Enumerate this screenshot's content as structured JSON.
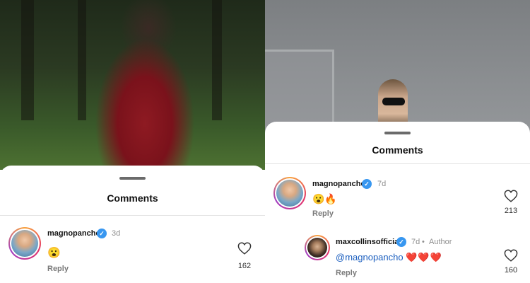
{
  "left_panel": {
    "sheet_title": "Comments",
    "comment": {
      "username": "magnopancho",
      "time": "3d",
      "text": "😮",
      "reply_label": "Reply",
      "like_count": "162"
    }
  },
  "right_panel": {
    "sheet_title": "Comments",
    "comment": {
      "username": "magnopancho",
      "time": "7d",
      "text": "😮🔥",
      "reply_label": "Reply",
      "like_count": "213"
    },
    "reply": {
      "username": "maxcollinsofficial",
      "time": "7d",
      "separator": "•",
      "author_badge": "Author",
      "mention": "@magnopancho",
      "hearts": "❤️❤️❤️",
      "reply_label": "Reply",
      "like_count": "160"
    }
  },
  "icons": {
    "verified": "verified-badge-icon",
    "like": "heart-outline-icon",
    "verified_glyph": "✓"
  },
  "colors": {
    "verified_blue": "#3897f0",
    "mention_blue": "#1c5fbf",
    "heart_red": "#e0221f"
  }
}
